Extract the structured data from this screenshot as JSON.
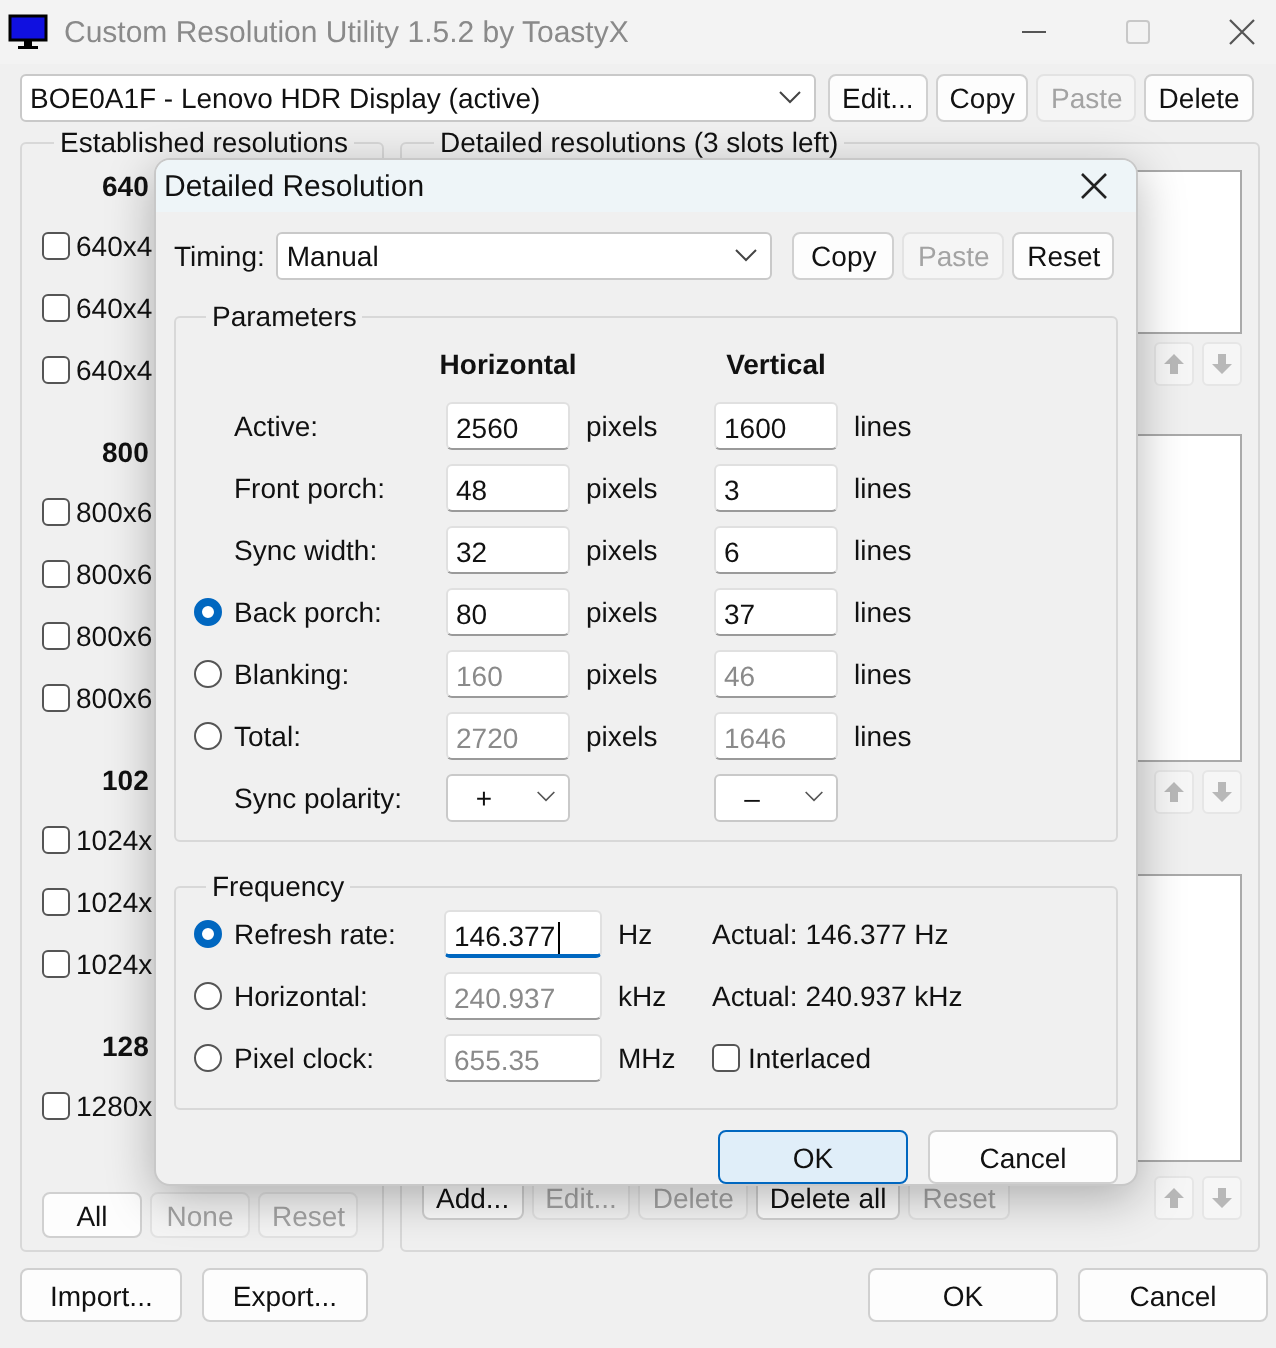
{
  "window": {
    "title": "Custom Resolution Utility 1.5.2 by ToastyX"
  },
  "device": {
    "value": "BOE0A1F - Lenovo HDR Display (active)",
    "buttons": [
      {
        "label": "Edit...",
        "disabled": false
      },
      {
        "label": "Copy",
        "disabled": false
      },
      {
        "label": "Paste",
        "disabled": true
      },
      {
        "label": "Delete",
        "disabled": false
      }
    ]
  },
  "established": {
    "title": "Established resolutions",
    "groups": [
      {
        "header": "640",
        "items": [
          {
            "label": "640x4",
            "checked": false
          },
          {
            "label": "640x4",
            "checked": false
          },
          {
            "label": "640x4",
            "checked": false
          }
        ]
      },
      {
        "header": "800",
        "items": [
          {
            "label": "800x6",
            "checked": false
          },
          {
            "label": "800x6",
            "checked": false
          },
          {
            "label": "800x6",
            "checked": false
          },
          {
            "label": "800x6",
            "checked": false
          }
        ]
      },
      {
        "header": "102",
        "items": [
          {
            "label": "1024x",
            "checked": false
          },
          {
            "label": "1024x",
            "checked": false
          },
          {
            "label": "1024x",
            "checked": false
          }
        ]
      },
      {
        "header": "128",
        "items": [
          {
            "label": "1280x",
            "checked": false
          }
        ]
      }
    ],
    "buttons": [
      {
        "label": "All",
        "disabled": false
      },
      {
        "label": "None",
        "disabled": true
      },
      {
        "label": "Reset",
        "disabled": true
      }
    ]
  },
  "detailed": {
    "title": "Detailed resolutions (3 slots left)",
    "buttons": [
      {
        "label": "Add...",
        "disabled": false
      },
      {
        "label": "Edit...",
        "disabled": true
      },
      {
        "label": "Delete",
        "disabled": true
      },
      {
        "label": "Delete all",
        "disabled": false
      },
      {
        "label": "Reset",
        "disabled": true
      }
    ]
  },
  "footer": {
    "left": [
      {
        "label": "Import..."
      },
      {
        "label": "Export..."
      }
    ],
    "right": [
      {
        "label": "OK"
      },
      {
        "label": "Cancel"
      }
    ]
  },
  "dialog": {
    "title": "Detailed Resolution",
    "timing_label": "Timing:",
    "timing": "Manual",
    "timing_buttons": [
      {
        "label": "Copy",
        "disabled": false
      },
      {
        "label": "Paste",
        "disabled": true
      },
      {
        "label": "Reset",
        "disabled": false
      }
    ],
    "parameters": {
      "title": "Parameters",
      "horizontal": "Horizontal",
      "vertical": "Vertical",
      "rows": [
        {
          "kind": "plain",
          "label": "Active:",
          "h": "2560",
          "h_unit": "pixels",
          "v": "1600",
          "v_unit": "lines",
          "disabled": false
        },
        {
          "kind": "plain",
          "label": "Front porch:",
          "h": "48",
          "h_unit": "pixels",
          "v": "3",
          "v_unit": "lines",
          "disabled": false
        },
        {
          "kind": "plain",
          "label": "Sync width:",
          "h": "32",
          "h_unit": "pixels",
          "v": "6",
          "v_unit": "lines",
          "disabled": false
        },
        {
          "kind": "radio",
          "selected": true,
          "label": "Back porch:",
          "h": "80",
          "h_unit": "pixels",
          "v": "37",
          "v_unit": "lines",
          "disabled": false
        },
        {
          "kind": "radio",
          "selected": false,
          "label": "Blanking:",
          "h": "160",
          "h_unit": "pixels",
          "v": "46",
          "v_unit": "lines",
          "disabled": true
        },
        {
          "kind": "radio",
          "selected": false,
          "label": "Total:",
          "h": "2720",
          "h_unit": "pixels",
          "v": "1646",
          "v_unit": "lines",
          "disabled": true
        }
      ],
      "polarity": {
        "label": "Sync polarity:",
        "h": "+",
        "v": "–"
      }
    },
    "frequency": {
      "title": "Frequency",
      "rows": [
        {
          "selected": true,
          "label": "Refresh rate:",
          "value": "146.377",
          "unit": "Hz",
          "disabled": false,
          "focused": true,
          "extra": {
            "kind": "text",
            "text": "Actual: 146.377 Hz"
          }
        },
        {
          "selected": false,
          "label": "Horizontal:",
          "value": "240.937",
          "unit": "kHz",
          "disabled": true,
          "focused": false,
          "extra": {
            "kind": "text",
            "text": "Actual: 240.937 kHz"
          }
        },
        {
          "selected": false,
          "label": "Pixel clock:",
          "value": "655.35",
          "unit": "MHz",
          "disabled": true,
          "focused": false,
          "extra": {
            "kind": "checkbox",
            "text": "Interlaced",
            "checked": false
          }
        }
      ]
    },
    "buttons": [
      {
        "label": "OK",
        "default": true
      },
      {
        "label": "Cancel",
        "default": false
      }
    ]
  }
}
